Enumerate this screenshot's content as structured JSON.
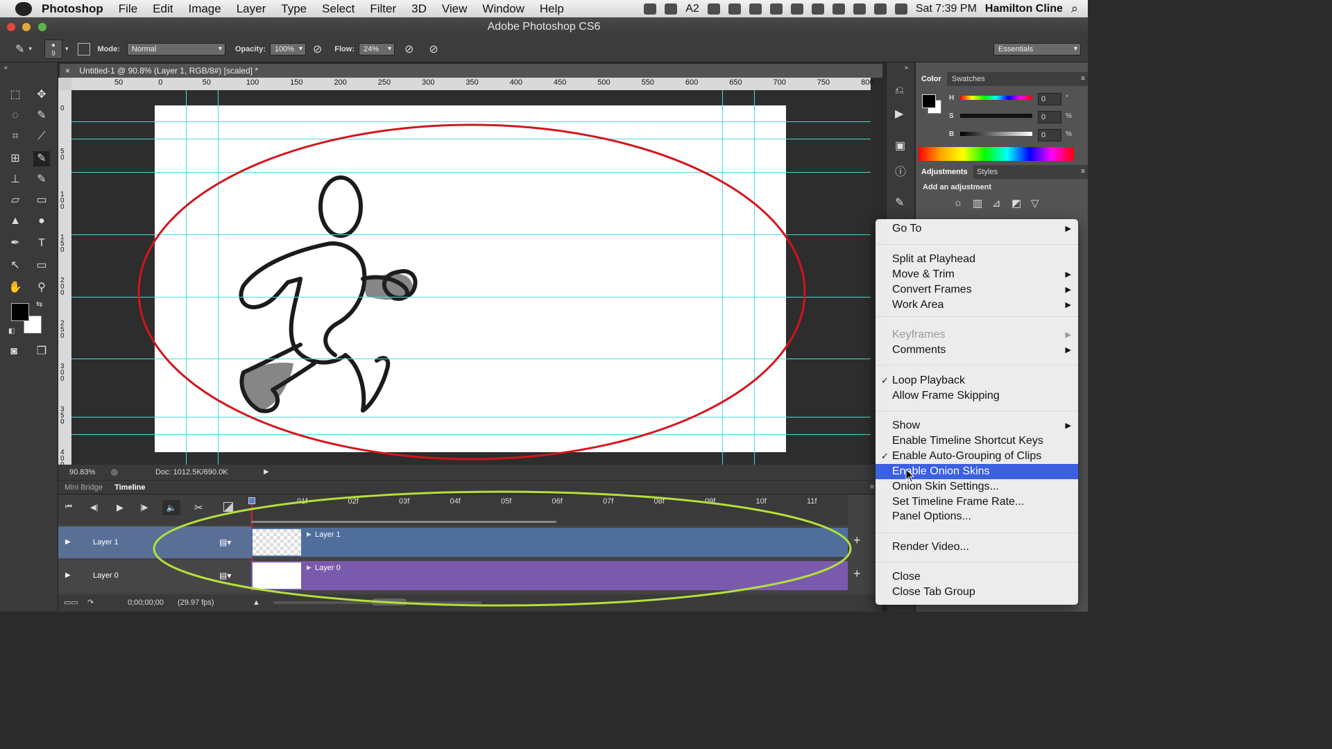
{
  "menubar": {
    "app_name": "Photoshop",
    "items": [
      "File",
      "Edit",
      "Image",
      "Layer",
      "Type",
      "Select",
      "Filter",
      "3D",
      "View",
      "Window",
      "Help"
    ],
    "battery_count": "2",
    "clock": "Sat 7:39 PM",
    "user": "Hamilton Cline"
  },
  "window": {
    "title": "Adobe Photoshop CS6"
  },
  "options": {
    "brush_size": "9",
    "mode_label": "Mode:",
    "mode_value": "Normal",
    "opacity_label": "Opacity:",
    "opacity_value": "100%",
    "flow_label": "Flow:",
    "flow_value": "24%",
    "workspace": "Essentials"
  },
  "document": {
    "tab_title": "Untitled-1 @ 90.8% (Layer 1, RGB/8#) [scaled] *",
    "ruler_h": [
      "50",
      "0",
      "50",
      "100",
      "150",
      "200",
      "250",
      "300",
      "350",
      "400",
      "450",
      "500",
      "550",
      "600",
      "650",
      "700",
      "750",
      "800"
    ],
    "ruler_v": [
      "0",
      "50",
      "100",
      "150",
      "200",
      "250",
      "300",
      "350",
      "400",
      "450"
    ],
    "zoom": "90.83%",
    "doc_size": "Doc: 1012.5K/690.0K"
  },
  "timeline": {
    "tabs": [
      "Mini Bridge",
      "Timeline"
    ],
    "ruler": [
      "01f",
      "02f",
      "03f",
      "04f",
      "05f",
      "06f",
      "07f",
      "08f",
      "09f",
      "10f",
      "11f"
    ],
    "tracks": [
      {
        "name": "Layer 1",
        "clip": "Layer 1",
        "color": "#4f6e9c"
      },
      {
        "name": "Layer 0",
        "clip": "Layer 0",
        "color": "#7a5aac"
      }
    ],
    "timecode": "0;00;00;00",
    "fps": "(29.97 fps)"
  },
  "panels": {
    "color_tabs": [
      "Color",
      "Swatches"
    ],
    "hsb": [
      {
        "label": "H",
        "value": "0",
        "unit": "°"
      },
      {
        "label": "S",
        "value": "0",
        "unit": "%"
      },
      {
        "label": "B",
        "value": "0",
        "unit": "%"
      }
    ],
    "adj_tabs": [
      "Adjustments",
      "Styles"
    ],
    "adj_title": "Add an adjustment"
  },
  "context_menu": {
    "items": [
      {
        "label": "Go To",
        "submenu": true
      },
      {
        "label": "Split at Playhead"
      },
      {
        "label": "Move & Trim",
        "submenu": true
      },
      {
        "label": "Convert Frames",
        "submenu": true
      },
      {
        "label": "Work Area",
        "submenu": true
      },
      {
        "label": "Keyframes",
        "submenu": true,
        "disabled": true
      },
      {
        "label": "Comments",
        "submenu": true
      },
      {
        "label": "Loop Playback",
        "checked": true
      },
      {
        "label": "Allow Frame Skipping"
      },
      {
        "label": "Show",
        "submenu": true
      },
      {
        "label": "Enable Timeline Shortcut Keys"
      },
      {
        "label": "Enable Auto-Grouping of Clips",
        "checked": true
      },
      {
        "label": "Enable Onion Skins",
        "highlighted": true
      },
      {
        "label": "Onion Skin Settings..."
      },
      {
        "label": "Set Timeline Frame Rate..."
      },
      {
        "label": "Panel Options..."
      },
      {
        "label": "Render Video..."
      },
      {
        "label": "Close"
      },
      {
        "label": "Close Tab Group"
      }
    ]
  },
  "annotations": {
    "canvas_ellipse_color": "#d4141c",
    "timeline_ellipse_color": "#b4e03c"
  }
}
